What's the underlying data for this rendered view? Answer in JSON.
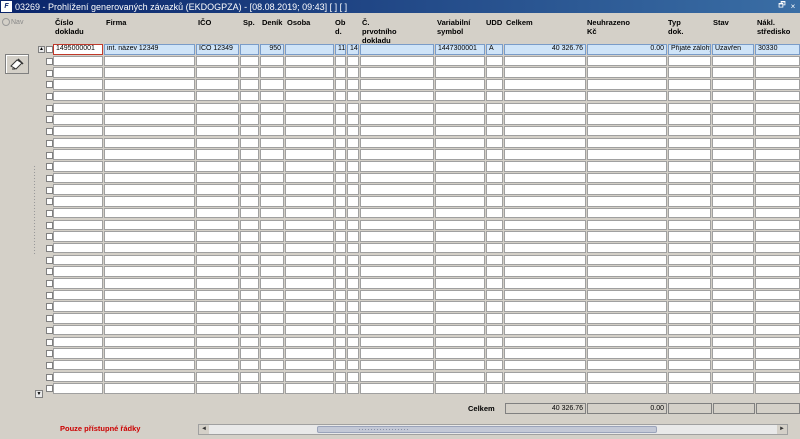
{
  "window": {
    "title": "03269 - Prohlížení generovaných závazků (EKDOGPZA) - [08.08.2019; 09:43]  [ ]  [ ]",
    "app_icon": "F",
    "restore_glyph": "🗗",
    "close_glyph": "×"
  },
  "toolbar": {
    "nav_label": "Nav"
  },
  "columns": [
    {
      "key": "cislo",
      "label": "Číslo\ndokladu"
    },
    {
      "key": "firma",
      "label": "Firma"
    },
    {
      "key": "ico",
      "label": "IČO"
    },
    {
      "key": "sp",
      "label": "Sp."
    },
    {
      "key": "denik",
      "label": "Deník"
    },
    {
      "key": "osoba",
      "label": "Osoba"
    },
    {
      "key": "obd",
      "label": "Ob\nd."
    },
    {
      "key": "blank",
      "label": ""
    },
    {
      "key": "prvotni",
      "label": "Č. prvotního\ndokladu"
    },
    {
      "key": "vs",
      "label": "Variabilní\nsymbol"
    },
    {
      "key": "udd",
      "label": "UDD"
    },
    {
      "key": "celkem",
      "label": "Celkem"
    },
    {
      "key": "neuhr",
      "label": "Neuhrazeno Kč"
    },
    {
      "key": "typ",
      "label": "Typ\ndok."
    },
    {
      "key": "stav",
      "label": "Stav"
    },
    {
      "key": "nakl",
      "label": "Nákl.\nstředisko"
    }
  ],
  "rows": [
    {
      "cislo": "1495000001",
      "firma": "int. název 12349",
      "ico": "IČO 12349",
      "sp": "",
      "denik": "950",
      "osoba": "",
      "obd": "11",
      "blank": "14",
      "prvotni": "",
      "vs": "1447300001",
      "udd": "A",
      "celkem": "40 326.76",
      "neuhr": "0.00",
      "typ": "Přijaté zálohy",
      "stav": "Uzavřen",
      "nakl": "30330"
    }
  ],
  "empty_row_count": 29,
  "totals": {
    "label": "Celkem",
    "celkem": "40 326.76",
    "neuhr": "0.00"
  },
  "footer": {
    "note": "Pouze přístupné řádky"
  },
  "scroll": {
    "up": "▲",
    "down": "▼",
    "left": "◄",
    "right": "►"
  }
}
